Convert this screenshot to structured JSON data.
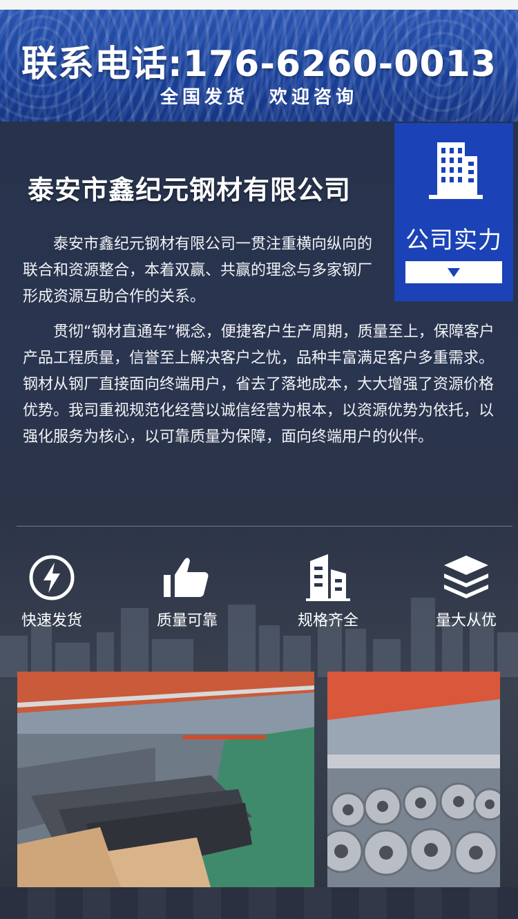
{
  "header": {
    "phone_line": "联系电话:176-6260-0013",
    "tagline": "全国发货  欢迎咨询"
  },
  "company": {
    "name": "泰安市鑫纪元钢材有限公司"
  },
  "badge": {
    "label": "公司实力",
    "icon": "building-icon",
    "arrow_icon": "triangle-down-icon"
  },
  "intro": {
    "paragraph1": "泰安市鑫纪元钢材有限公司一贯注重横向纵向的联合和资源整合，本着双赢、共赢的理念与多家钢厂形成资源互助合作的关系。",
    "paragraph2": "贯彻“钢材直通车”概念，便捷客户生产周期，质量至上，保障客户产品工程质量，信誉至上解决客户之忧，品种丰富满足客户多重需求。钢材从钢厂直接面向终端用户，省去了落地成本，大大增强了资源价格优势。我司重视规范化经营以诚信经营为根本，以资源优势为依托，以强化服务为核心，以可靠质量为保障，面向终端用户的伙伴。"
  },
  "features": [
    {
      "label": "快速发货",
      "icon": "lightning-icon"
    },
    {
      "label": "质量可靠",
      "icon": "thumbs-up-icon"
    },
    {
      "label": "规格齐全",
      "icon": "buildings-icon"
    },
    {
      "label": "量大从优",
      "icon": "layers-icon"
    }
  ],
  "colors": {
    "brand_blue": "#1b42b6",
    "banner_blue": "#1c44a0",
    "background": "#2a3550"
  }
}
